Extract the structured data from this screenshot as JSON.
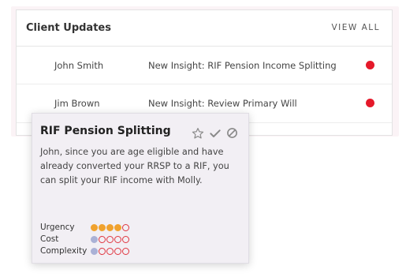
{
  "panel": {
    "title": "Client Updates",
    "view_all_label": "VIEW ALL",
    "rows": [
      {
        "name": "John Smith",
        "description": "New Insight: RIF Pension Income Splitting",
        "status_color": "#e5192a"
      },
      {
        "name": "Jim Brown",
        "description": "New Insight: Review Primary Will",
        "status_color": "#e5192a"
      }
    ]
  },
  "card": {
    "title": "RIF Pension Splitting",
    "icons": [
      "star-outline-icon",
      "check-icon",
      "ban-icon"
    ],
    "body": "John, since you are age eligible and have already converted your RRSP to a RIF, you can split your RIF income with Molly.",
    "metrics": [
      {
        "label": "Urgency",
        "rating": 4,
        "max": 5,
        "fill_color": "#f0a22e"
      },
      {
        "label": "Cost",
        "rating": 1,
        "max": 5,
        "fill_color": "#aab1d6"
      },
      {
        "label": "Complexity",
        "rating": 1,
        "max": 5,
        "fill_color": "#aab1d6"
      }
    ],
    "empty_ring_color": "#e0353f"
  }
}
